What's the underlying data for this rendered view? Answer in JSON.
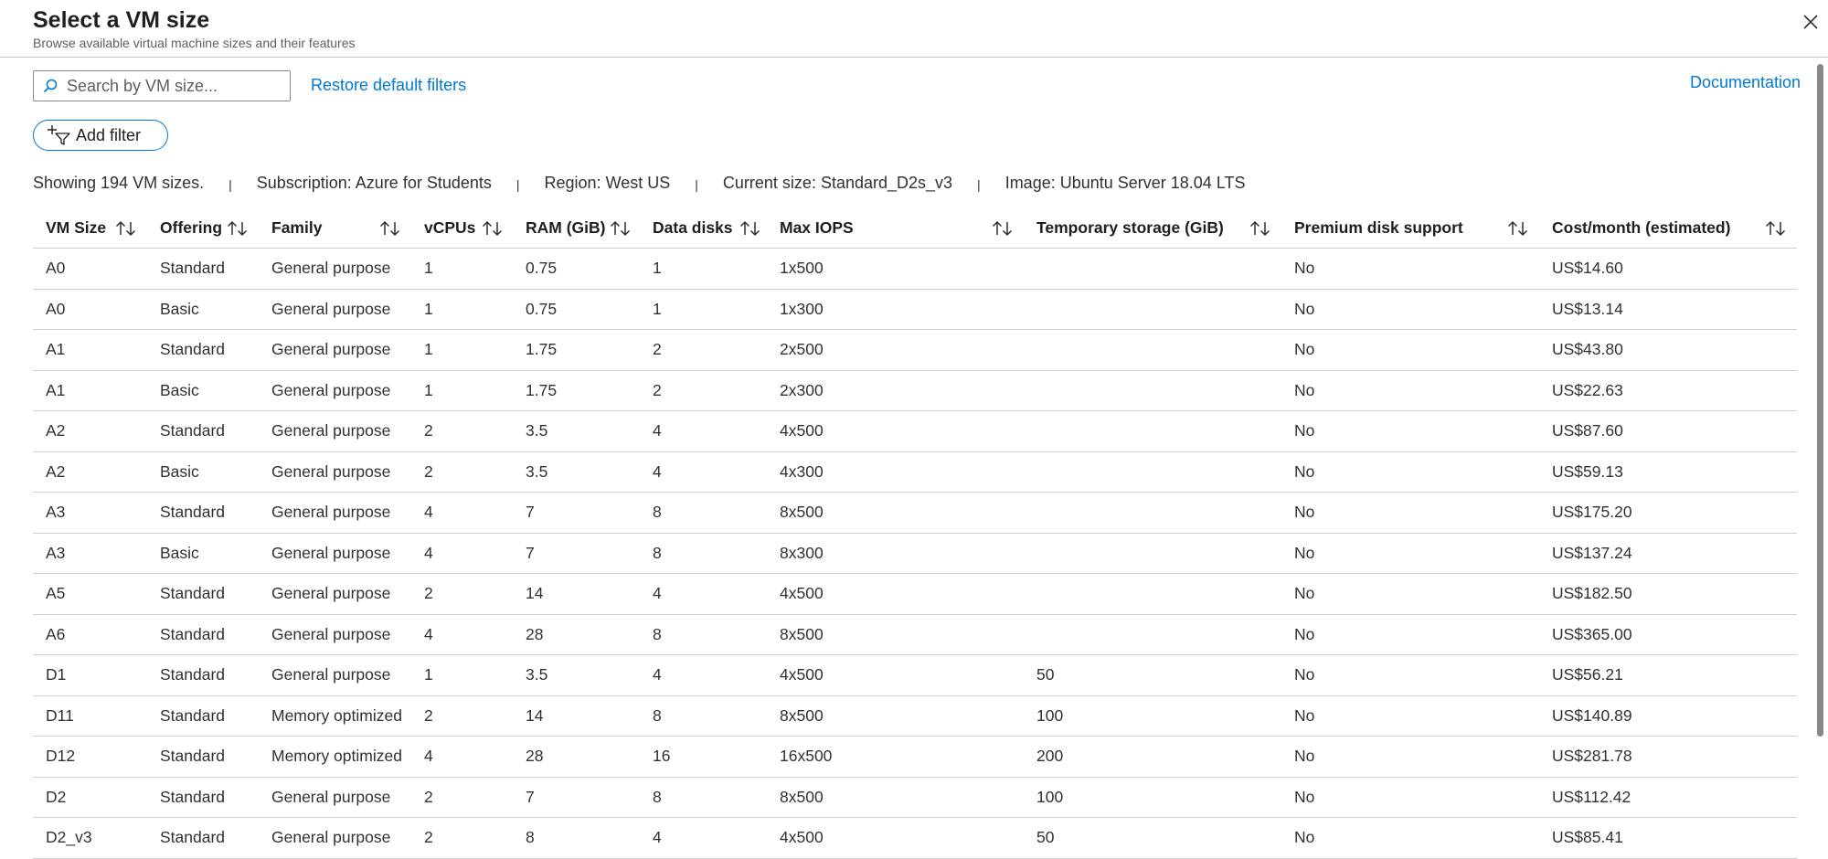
{
  "header": {
    "title": "Select a VM size",
    "subtitle": "Browse available virtual machine sizes and their features"
  },
  "toolbar": {
    "search_placeholder": "Search by VM size...",
    "restore_label": "Restore default filters",
    "documentation_label": "Documentation",
    "add_filter_label": "Add filter"
  },
  "summary": {
    "showing": "Showing 194 VM sizes.",
    "subscription": "Subscription: Azure for Students",
    "region": "Region: West US",
    "current_size": "Current size: Standard_D2s_v3",
    "image": "Image: Ubuntu Server 18.04 LTS"
  },
  "table": {
    "columns": [
      "VM Size",
      "Offering",
      "Family",
      "vCPUs",
      "RAM (GiB)",
      "Data disks",
      "Max IOPS",
      "Temporary storage (GiB)",
      "Premium disk support",
      "Cost/month (estimated)"
    ],
    "rows": [
      [
        "A0",
        "Standard",
        "General purpose",
        "1",
        "0.75",
        "1",
        "1x500",
        "",
        "No",
        "US$14.60"
      ],
      [
        "A0",
        "Basic",
        "General purpose",
        "1",
        "0.75",
        "1",
        "1x300",
        "",
        "No",
        "US$13.14"
      ],
      [
        "A1",
        "Standard",
        "General purpose",
        "1",
        "1.75",
        "2",
        "2x500",
        "",
        "No",
        "US$43.80"
      ],
      [
        "A1",
        "Basic",
        "General purpose",
        "1",
        "1.75",
        "2",
        "2x300",
        "",
        "No",
        "US$22.63"
      ],
      [
        "A2",
        "Standard",
        "General purpose",
        "2",
        "3.5",
        "4",
        "4x500",
        "",
        "No",
        "US$87.60"
      ],
      [
        "A2",
        "Basic",
        "General purpose",
        "2",
        "3.5",
        "4",
        "4x300",
        "",
        "No",
        "US$59.13"
      ],
      [
        "A3",
        "Standard",
        "General purpose",
        "4",
        "7",
        "8",
        "8x500",
        "",
        "No",
        "US$175.20"
      ],
      [
        "A3",
        "Basic",
        "General purpose",
        "4",
        "7",
        "8",
        "8x300",
        "",
        "No",
        "US$137.24"
      ],
      [
        "A5",
        "Standard",
        "General purpose",
        "2",
        "14",
        "4",
        "4x500",
        "",
        "No",
        "US$182.50"
      ],
      [
        "A6",
        "Standard",
        "General purpose",
        "4",
        "28",
        "8",
        "8x500",
        "",
        "No",
        "US$365.00"
      ],
      [
        "D1",
        "Standard",
        "General purpose",
        "1",
        "3.5",
        "4",
        "4x500",
        "50",
        "No",
        "US$56.21"
      ],
      [
        "D11",
        "Standard",
        "Memory optimized",
        "2",
        "14",
        "8",
        "8x500",
        "100",
        "No",
        "US$140.89"
      ],
      [
        "D12",
        "Standard",
        "Memory optimized",
        "4",
        "28",
        "16",
        "16x500",
        "200",
        "No",
        "US$281.78"
      ],
      [
        "D2",
        "Standard",
        "General purpose",
        "2",
        "7",
        "8",
        "8x500",
        "100",
        "No",
        "US$112.42"
      ],
      [
        "D2_v3",
        "Standard",
        "General purpose",
        "2",
        "8",
        "4",
        "4x500",
        "50",
        "No",
        "US$85.41"
      ]
    ]
  },
  "icons": {
    "search": "search-icon",
    "close": "close-icon",
    "add_filter": "add-filter-icon",
    "sort": "sort-arrows-icon"
  },
  "colors": {
    "link": "#0078d4",
    "text": "#323130",
    "border": "#d2d0ce"
  }
}
